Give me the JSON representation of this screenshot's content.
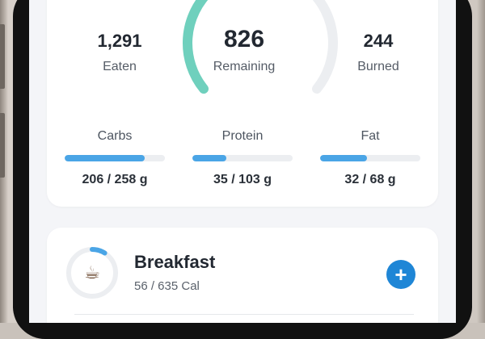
{
  "summary": {
    "eaten": {
      "value": "1,291",
      "label": "Eaten"
    },
    "remaining": {
      "value": "826",
      "label": "Remaining"
    },
    "burned": {
      "value": "244",
      "label": "Burned"
    },
    "gauge_fraction": 0.61,
    "gauge_color": "#6fd0bd",
    "track_color": "#eceef1"
  },
  "macros": [
    {
      "name": "Carbs",
      "value": "206 / 258 g",
      "fraction": 0.8
    },
    {
      "name": "Protein",
      "value": "35 / 103 g",
      "fraction": 0.34
    },
    {
      "name": "Fat",
      "value": "32 / 68 g",
      "fraction": 0.47
    }
  ],
  "meal": {
    "title": "Breakfast",
    "subtitle": "56 / 635 Cal",
    "icon": "coffee-icon",
    "progress_fraction": 0.09,
    "ring_color": "#4aa5e6",
    "add_button_color": "#1f86d6"
  }
}
